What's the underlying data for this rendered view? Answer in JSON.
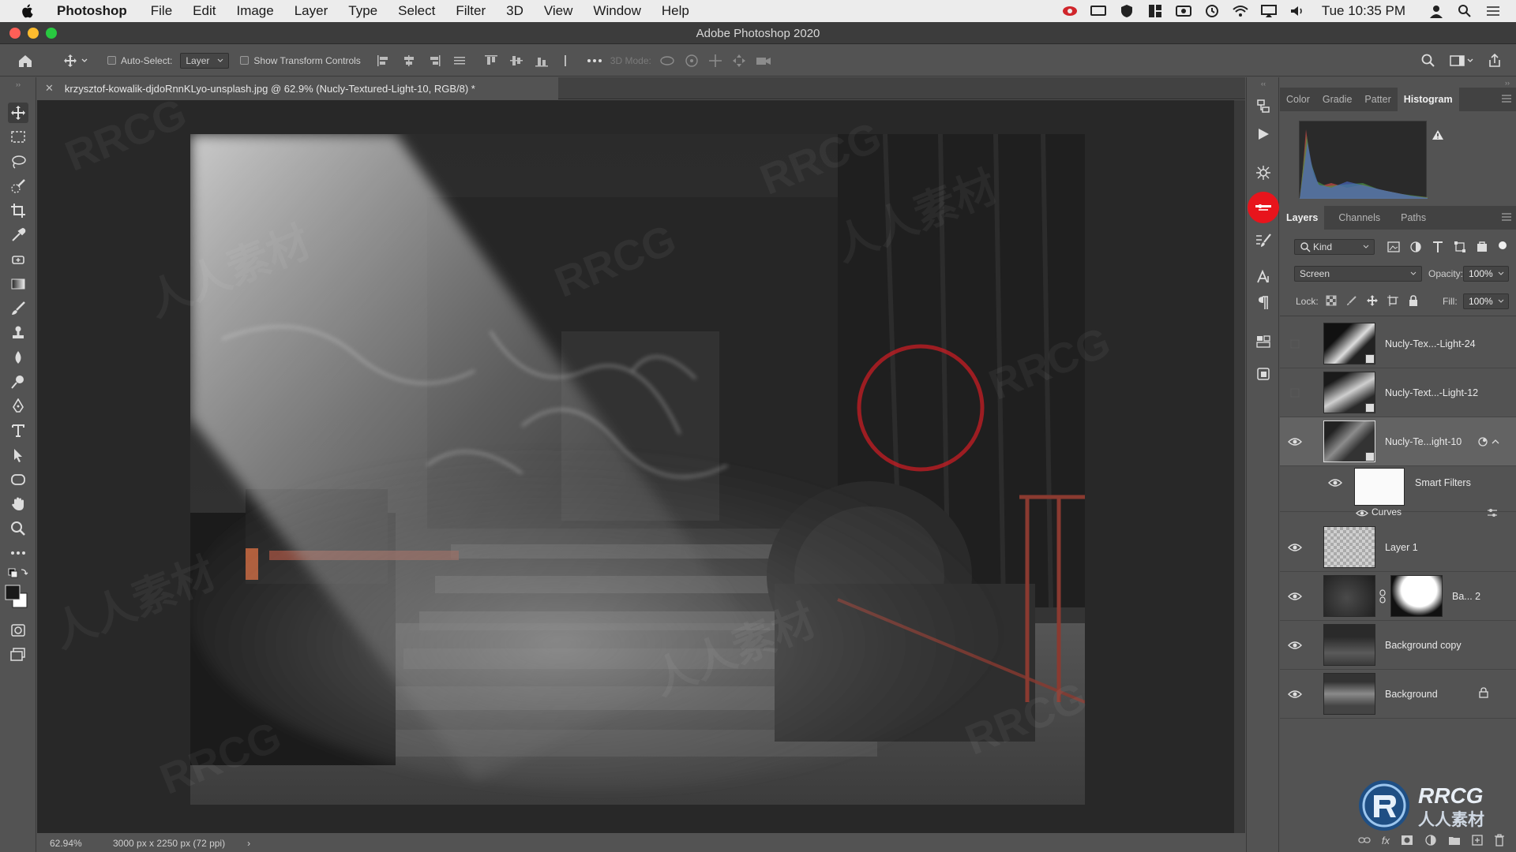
{
  "menubar": {
    "items": [
      "Photoshop",
      "File",
      "Edit",
      "Image",
      "Layer",
      "Type",
      "Select",
      "Filter",
      "3D",
      "View",
      "Window",
      "Help"
    ],
    "clock": "Tue 10:35 PM"
  },
  "window": {
    "title": "Adobe Photoshop 2020"
  },
  "options_bar": {
    "auto_select_label": "Auto-Select:",
    "auto_select_value": "Layer",
    "show_transform_label": "Show Transform Controls",
    "mode_3d_label": "3D Mode:"
  },
  "document": {
    "tab_title": "krzysztof-kowalik-djdoRnnKLyo-unsplash.jpg @ 62.9% (Nucly-Textured-Light-10, RGB/8) *",
    "zoom": "62.94%",
    "dimensions": "3000 px x 2250 px (72 ppi)"
  },
  "panels": {
    "top_tabs": [
      "Color",
      "Gradie",
      "Patter",
      "Histogram"
    ],
    "active_top_tab": "Histogram",
    "layer_tabs": [
      "Layers",
      "Channels",
      "Paths"
    ],
    "active_layer_tab": "Layers",
    "filter_kind": "Kind",
    "blend_mode": "Screen",
    "opacity_label": "Opacity:",
    "opacity_value": "100%",
    "lock_label": "Lock:",
    "fill_label": "Fill:",
    "fill_value": "100%"
  },
  "layers": [
    {
      "name": "Nucly-Tex...-Light-24",
      "visible": false
    },
    {
      "name": "Nucly-Text...-Light-12",
      "visible": false
    },
    {
      "name": "Nucly-Te...ight-10",
      "visible": true,
      "selected": true
    },
    {
      "name": "Smart Filters",
      "visible": true
    },
    {
      "name": "Curves",
      "visible": true
    },
    {
      "name": "Layer 1",
      "visible": true
    },
    {
      "name": "Ba... 2",
      "visible": true
    },
    {
      "name": "Background copy",
      "visible": true
    },
    {
      "name": "Background",
      "visible": true,
      "locked": true
    }
  ],
  "watermark": {
    "brand": "RRCG",
    "brand_cn": "人人素材"
  },
  "colors": {
    "highlight_red": "#e8141c",
    "panel_bg": "#535353",
    "canvas_bg": "#282828"
  }
}
